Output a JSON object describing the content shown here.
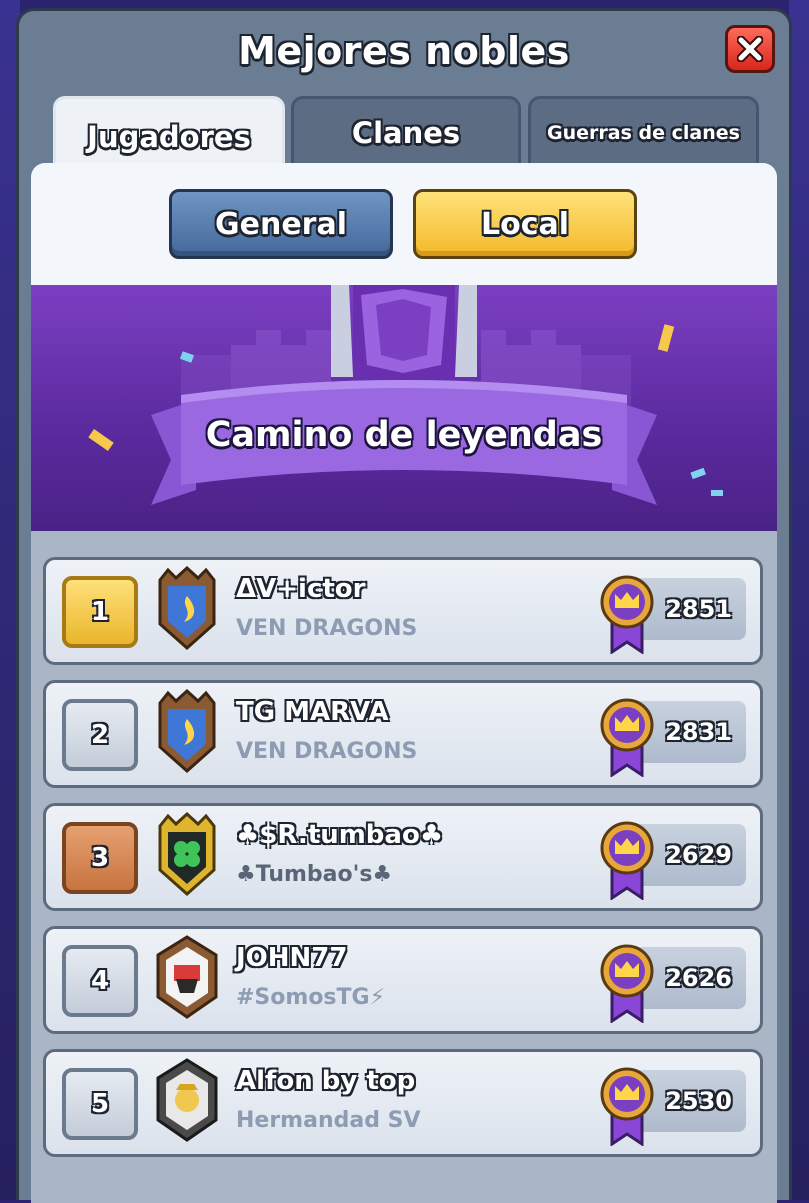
{
  "window": {
    "title": "Mejores nobles",
    "close_icon": "close-icon"
  },
  "tabs": [
    {
      "label": "Jugadores",
      "active": true
    },
    {
      "label": "Clanes",
      "active": false
    },
    {
      "label": "Guerras de clanes",
      "active": false
    }
  ],
  "scope": {
    "general_label": "General",
    "local_label": "Local",
    "selected": "Local"
  },
  "banner": {
    "title": "Camino de leyendas"
  },
  "players": [
    {
      "rank": "1",
      "name": "ΔV+ictor",
      "clan": "VEN DRAGONS",
      "score": "2851",
      "badge_icon": "fire-shield-icon",
      "rank_style": "gold"
    },
    {
      "rank": "2",
      "name": "TG MARVA",
      "clan": "VEN DRAGONS",
      "score": "2831",
      "badge_icon": "fire-shield-icon",
      "rank_style": "silver"
    },
    {
      "rank": "3",
      "name": "♣$R.tumbao♣",
      "clan": "♣Tumbao's♣",
      "score": "2629",
      "badge_icon": "clover-shield-icon",
      "rank_style": "bronze"
    },
    {
      "rank": "4",
      "name": "JOHN77",
      "clan": "#SomosTG⚡",
      "score": "2626",
      "badge_icon": "skull-shield-icon",
      "rank_style": "silver"
    },
    {
      "rank": "5",
      "name": "Alfon by top",
      "clan": "Hermandad SV",
      "score": "2530",
      "badge_icon": "knight-shield-icon",
      "rank_style": "silver"
    }
  ],
  "colors": {
    "panel": "#6b7d93",
    "gold": "#f3b92a",
    "blue": "#44689a",
    "purple": "#5a2a9e"
  }
}
